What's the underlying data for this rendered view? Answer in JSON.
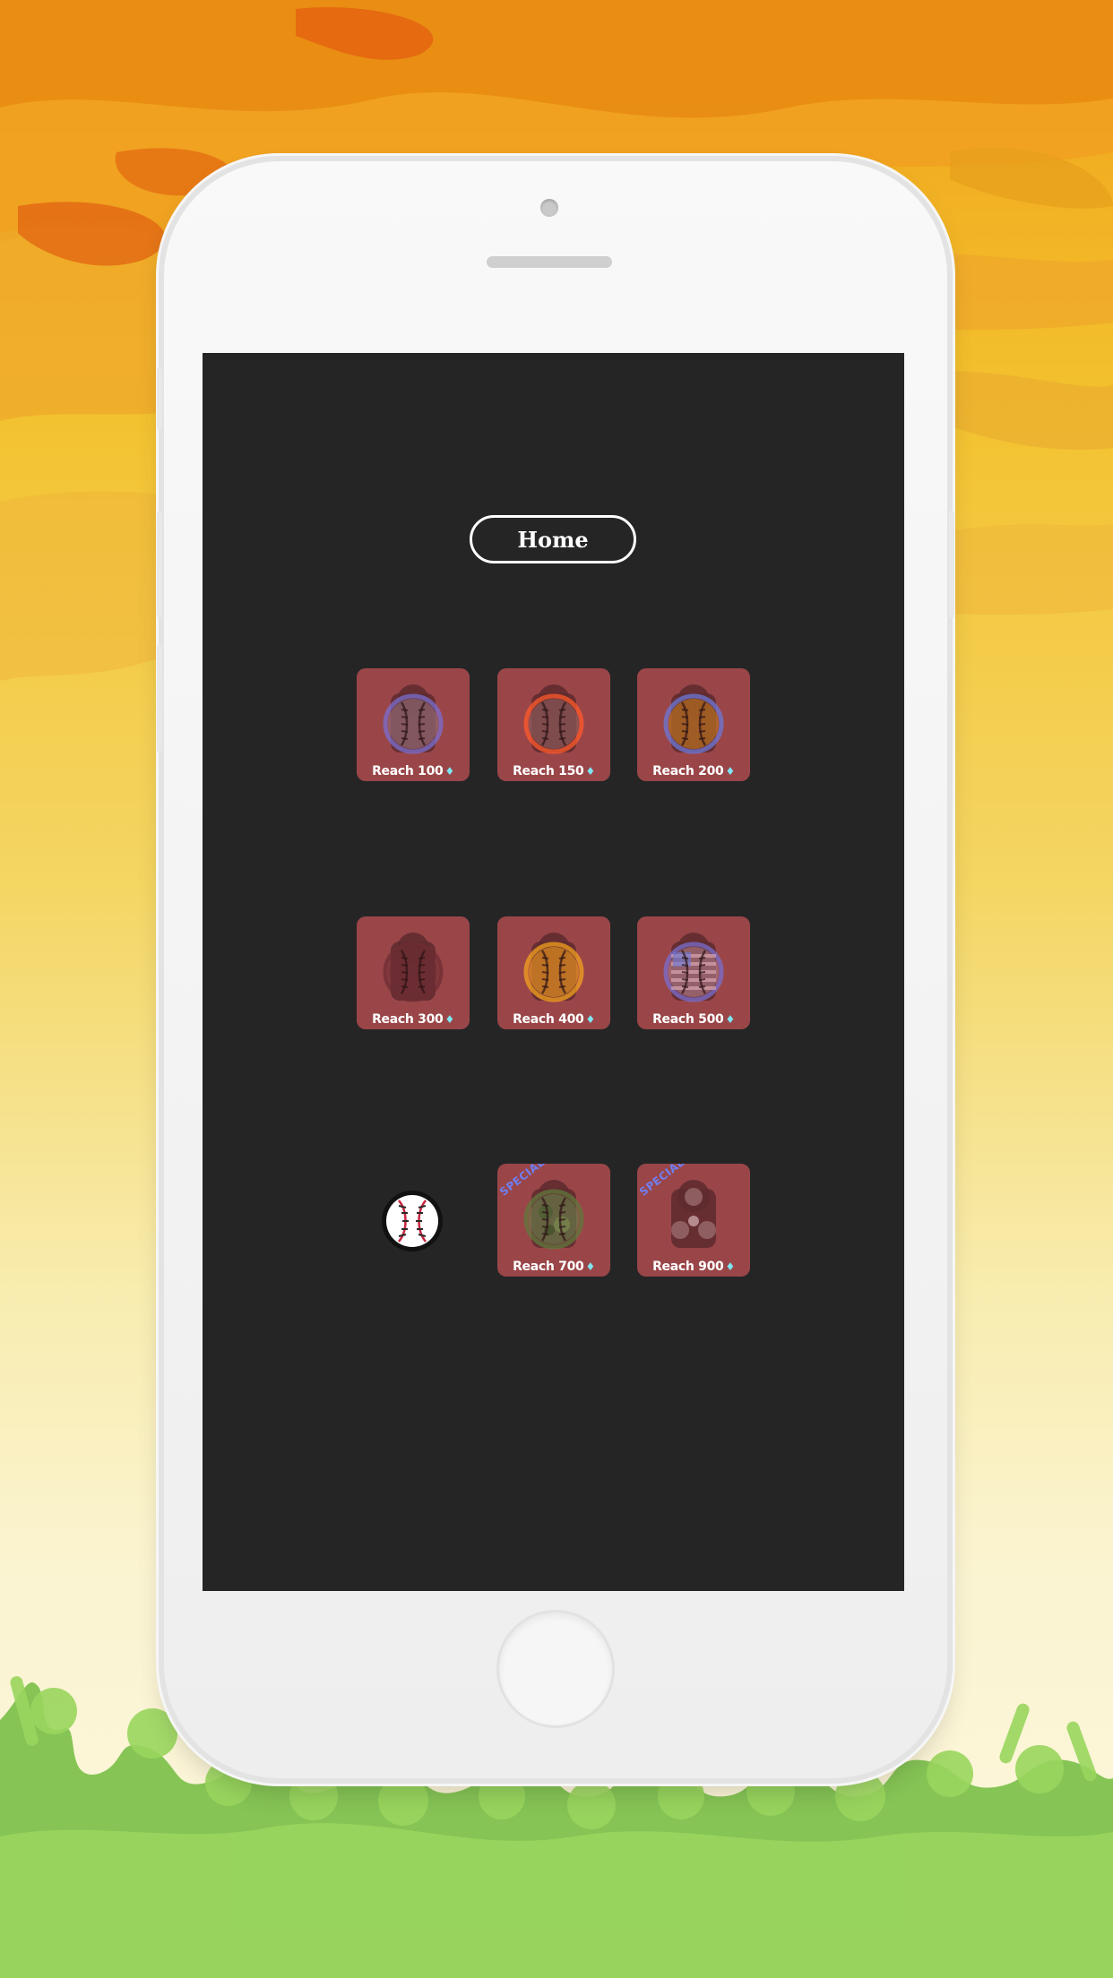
{
  "home_button": {
    "label": "Home"
  },
  "diamond_glyph": "♦",
  "rows": [
    [
      {
        "label": "Reach 100",
        "ball": "purple-ring-ball",
        "ring": "#7a6fd0",
        "fill": "#8e6a74",
        "special": ""
      },
      {
        "label": "Reach 150",
        "ball": "red-ring-ball",
        "ring": "#ff5a2a",
        "fill": "#8a5a5a",
        "special": ""
      },
      {
        "label": "Reach 200",
        "ball": "orange-ball-blue-ring",
        "ring": "#6b78d8",
        "fill": "#b8701f",
        "special": ""
      }
    ],
    [
      {
        "label": "Reach 300",
        "ball": "dark-ball",
        "ring": "#6e2e33",
        "fill": "#6e2e33",
        "special": ""
      },
      {
        "label": "Reach 400",
        "ball": "orange-ball",
        "ring": "#f3a21e",
        "fill": "#e49020",
        "special": ""
      },
      {
        "label": "Reach 500",
        "ball": "usa-flag-ball",
        "ring": "#7a6fd0",
        "fill": "#a87680",
        "special": ""
      }
    ],
    [
      {
        "label": "",
        "ball": "",
        "ring": "",
        "fill": "",
        "special": ""
      },
      {
        "label": "Reach 700",
        "ball": "camo-ball",
        "ring": "#5f7a3c",
        "fill": "#667a48",
        "special": "SPECIAL"
      },
      {
        "label": "Reach 900",
        "ball": "triple-ball",
        "ring": "",
        "fill": "",
        "special": "SPECIAL"
      }
    ]
  ],
  "selected_ball": {
    "icon": "baseball-icon",
    "stitch_color": "#c8243f"
  }
}
